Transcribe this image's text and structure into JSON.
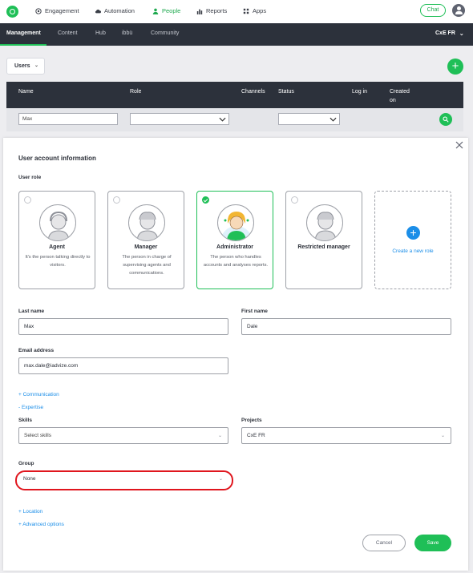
{
  "topnav": {
    "items": [
      {
        "label": "Engagement",
        "icon": "target-icon"
      },
      {
        "label": "Automation",
        "icon": "cloud-icon"
      },
      {
        "label": "People",
        "icon": "person-icon",
        "active": true
      },
      {
        "label": "Reports",
        "icon": "bar-chart-icon"
      },
      {
        "label": "Apps",
        "icon": "grid-icon"
      }
    ],
    "chat_label": "Chat"
  },
  "subnav": {
    "items": [
      "Management",
      "Content",
      "Hub",
      "ibbü",
      "Community"
    ],
    "workspace": "CxE FR"
  },
  "users": {
    "dropdown_label": "Users"
  },
  "table": {
    "headers": {
      "name": "Name",
      "role": "Role",
      "channels": "Channels",
      "status": "Status",
      "login": "Log in",
      "created_line1": "Created",
      "created_line2": "on"
    },
    "filter_name": "Max"
  },
  "panel": {
    "title": "User account information",
    "user_role_label": "User role",
    "roles": [
      {
        "name": "Agent",
        "desc": "It's the person talking directly to visitors."
      },
      {
        "name": "Manager",
        "desc": "The person in charge of supervising agents and communications."
      },
      {
        "name": "Administrator",
        "desc": "The person who handles accounts and analyses reports.",
        "selected": true
      },
      {
        "name": "Restricted manager",
        "desc": ""
      }
    ],
    "create_role_label": "Create a new role",
    "last_name_label": "Last name",
    "last_name_value": "Max",
    "first_name_label": "First name",
    "first_name_value": "Dale",
    "email_label": "Email address",
    "email_value": "max.dale@iadvize.com",
    "communication_link": "+ Communication",
    "expertise_link": "- Expertise",
    "skills_label": "Skills",
    "skills_value": "Select skills",
    "projects_label": "Projects",
    "projects_value": "CxE FR",
    "group_label": "Group",
    "group_value": "None",
    "location_link": "+ Location",
    "advanced_link": "+ Advanced options",
    "cancel_label": "Cancel",
    "save_label": "Save"
  },
  "colors": {
    "accent": "#1fbf57",
    "dark": "#2c313b",
    "link": "#1b8ee8",
    "highlight": "#e0161e"
  }
}
